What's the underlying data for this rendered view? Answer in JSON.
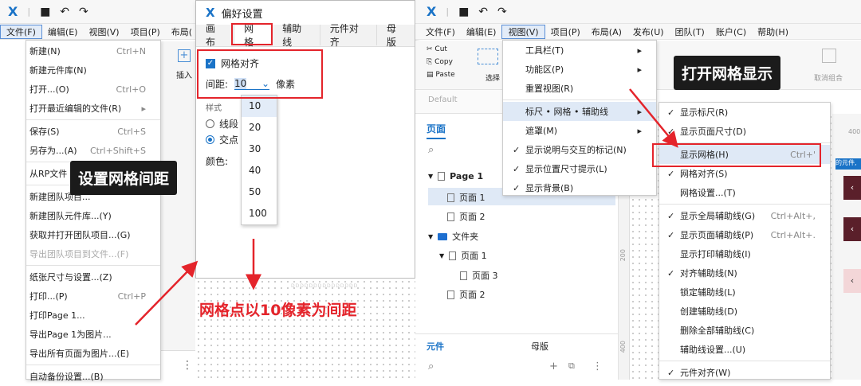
{
  "left_window": {
    "menubar": [
      "文件(F)",
      "编辑(E)",
      "视图(V)",
      "项目(P)",
      "布局("
    ],
    "file_menu": [
      {
        "label": "新建(N)",
        "shortcut": "Ctrl+N"
      },
      {
        "label": "新建元件库(N)",
        "shortcut": ""
      },
      {
        "label": "打开...(O)",
        "shortcut": "Ctrl+O"
      },
      {
        "label": "打开最近编辑的文件(R)",
        "shortcut": "▸"
      },
      {
        "label": "保存(S)",
        "shortcut": "Ctrl+S"
      },
      {
        "label": "另存为...(A)",
        "shortcut": "Ctrl+Shift+S"
      },
      {
        "label": "从RP文件",
        "shortcut": ""
      },
      {
        "label": "新建团队项目...",
        "shortcut": ""
      },
      {
        "label": "新建团队元件库...(Y)",
        "shortcut": ""
      },
      {
        "label": "获取并打开团队项目...(G)",
        "shortcut": ""
      },
      {
        "label": "导出团队项目到文件...(F)",
        "shortcut": ""
      },
      {
        "label": "纸张尺寸与设置...(Z)",
        "shortcut": ""
      },
      {
        "label": "打印...(P)",
        "shortcut": "Ctrl+P"
      },
      {
        "label": "打印Page 1...",
        "shortcut": ""
      },
      {
        "label": "导出Page 1为图片...",
        "shortcut": ""
      },
      {
        "label": "导出所有页面为图片...(E)",
        "shortcut": ""
      },
      {
        "label": "自动备份设置...(B)",
        "shortcut": ""
      }
    ],
    "side_labels": {
      "plus": "+",
      "insert": "插入"
    }
  },
  "annotations": {
    "grid_spacing": "设置网格间距",
    "grid_note": "网格点以10像素为间距",
    "show_grid": "打开网格显示"
  },
  "prefs": {
    "title": "偏好设置",
    "tabs": [
      "画布",
      "网格",
      "辅助线",
      "元件对齐",
      "母版"
    ],
    "snap_label": "网格对齐",
    "spacing_label": "间距:",
    "spacing_value": "10",
    "unit": "像素",
    "style_label": "样式",
    "opt_line": "线段",
    "opt_dot": "交点",
    "color_label": "颜色:",
    "spacing_options": [
      "10",
      "20",
      "30",
      "40",
      "50",
      "100"
    ],
    "canvas_text": "DDDDDDDDDDDDDDD"
  },
  "right_window": {
    "menubar": [
      "文件(F)",
      "编辑(E)",
      "视图(V)",
      "项目(P)",
      "布局(A)",
      "发布(U)",
      "团队(T)",
      "账户(C)",
      "帮助(H)"
    ],
    "toolbar": {
      "cut": "Cut",
      "copy": "Copy",
      "paste": "Paste",
      "select": "选择",
      "default": "Default",
      "unzip": "取消组合"
    },
    "pages_tab": "页面",
    "tree": [
      {
        "label": "Page 1",
        "icon": "doc",
        "level": 0
      },
      {
        "label": "页面 1",
        "icon": "doc",
        "level": 1
      },
      {
        "label": "页面 2",
        "icon": "doc",
        "level": 1
      },
      {
        "label": "文件夹",
        "icon": "folder",
        "level": 0
      },
      {
        "label": "页面 1",
        "icon": "doc",
        "level": 1
      },
      {
        "label": "页面 3",
        "icon": "doc",
        "level": 2
      },
      {
        "label": "页面 2",
        "icon": "doc",
        "level": 1
      }
    ],
    "bottom_tabs": [
      "元件",
      "母版"
    ],
    "ruler": [
      "200",
      "300",
      "400",
      "400"
    ],
    "view_menu": [
      {
        "label": "工具栏(T)",
        "check": false,
        "arrow": true
      },
      {
        "label": "功能区(P)",
        "check": false,
        "arrow": true
      },
      {
        "label": "重置视图(R)",
        "check": false,
        "arrow": false
      },
      {
        "label": "标尺 • 网格 • 辅助线",
        "check": false,
        "arrow": true
      },
      {
        "label": "遮罩(M)",
        "check": false,
        "arrow": true
      },
      {
        "label": "显示说明与交互的标记(N)",
        "check": true,
        "arrow": false
      },
      {
        "label": "显示位置尺寸提示(L)",
        "check": true,
        "arrow": false
      },
      {
        "label": "显示背景(B)",
        "check": true,
        "arrow": false
      }
    ],
    "submenu": [
      {
        "label": "显示标尺(R)",
        "check": true,
        "shortcut": ""
      },
      {
        "label": "显示页面尺寸(D)",
        "check": true,
        "shortcut": ""
      },
      {
        "label": "显示网格(H)",
        "check": false,
        "shortcut": "Ctrl+'"
      },
      {
        "label": "网格对齐(S)",
        "check": true,
        "shortcut": ""
      },
      {
        "label": "网格设置...(T)",
        "check": false,
        "shortcut": ""
      },
      {
        "label": "显示全局辅助线(G)",
        "check": true,
        "shortcut": "Ctrl+Alt+,"
      },
      {
        "label": "显示页面辅助线(P)",
        "check": true,
        "shortcut": "Ctrl+Alt+."
      },
      {
        "label": "显示打印辅助线(I)",
        "check": false,
        "shortcut": ""
      },
      {
        "label": "对齐辅助线(N)",
        "check": true,
        "shortcut": ""
      },
      {
        "label": "锁定辅助线(L)",
        "check": false,
        "shortcut": ""
      },
      {
        "label": "创建辅助线(D)",
        "check": false,
        "shortcut": ""
      },
      {
        "label": "删除全部辅助线(C)",
        "check": false,
        "shortcut": ""
      },
      {
        "label": "辅助线设置...(U)",
        "check": false,
        "shortcut": ""
      },
      {
        "label": "元件对齐(W)",
        "check": true,
        "shortcut": ""
      }
    ],
    "right_edge_text": "的元件,"
  },
  "colors": {
    "accent": "#1a73c7",
    "highlight": "#e4242b"
  }
}
